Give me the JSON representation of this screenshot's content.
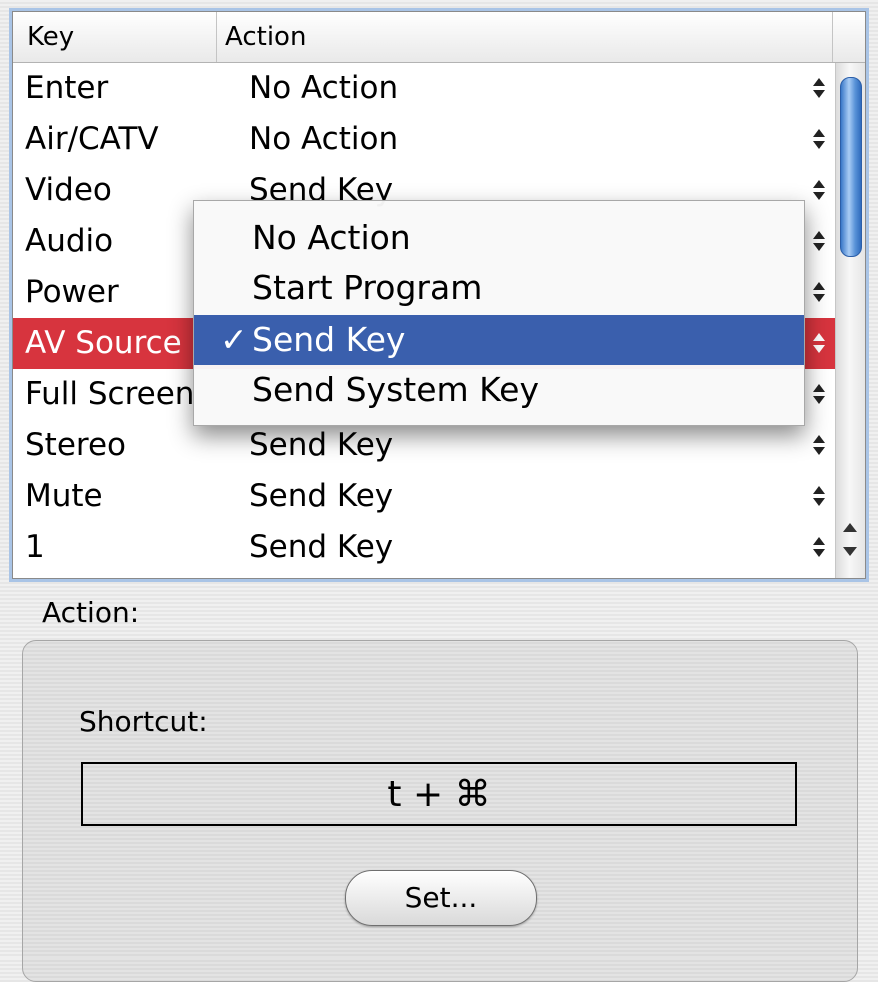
{
  "table": {
    "headers": {
      "key": "Key",
      "action": "Action"
    },
    "rows": [
      {
        "key": "Enter",
        "action": "No Action",
        "selected": false
      },
      {
        "key": "Air/CATV",
        "action": "No Action",
        "selected": false
      },
      {
        "key": "Video",
        "action": "Send Key",
        "selected": false
      },
      {
        "key": "Audio",
        "action": "",
        "selected": false
      },
      {
        "key": "Power",
        "action": "",
        "selected": false
      },
      {
        "key": "AV Source",
        "action": "",
        "selected": true
      },
      {
        "key": "Full Screen",
        "action": "",
        "selected": false
      },
      {
        "key": "Stereo",
        "action": "Send Key",
        "selected": false
      },
      {
        "key": "Mute",
        "action": "Send Key",
        "selected": false
      },
      {
        "key": "1",
        "action": "Send Key",
        "selected": false
      }
    ],
    "selected_row_color": "#d7343e"
  },
  "popup_menu": {
    "items": [
      {
        "label": "No Action",
        "checked": false
      },
      {
        "label": "Start Program",
        "checked": false
      },
      {
        "label": "Send Key",
        "checked": true
      },
      {
        "label": "Send System Key",
        "checked": false
      }
    ],
    "check_mark": "✓",
    "highlight_color": "#3a5fad"
  },
  "action_panel": {
    "title": "Action:",
    "shortcut_label": "Shortcut:",
    "shortcut_value": "t + ⌘",
    "set_button_label": "Set..."
  },
  "icons": {
    "row_popup_arrows": "up-down-arrows-icon",
    "scroll_up": "scroll-up-arrow-icon",
    "scroll_down": "scroll-down-arrow-icon"
  }
}
